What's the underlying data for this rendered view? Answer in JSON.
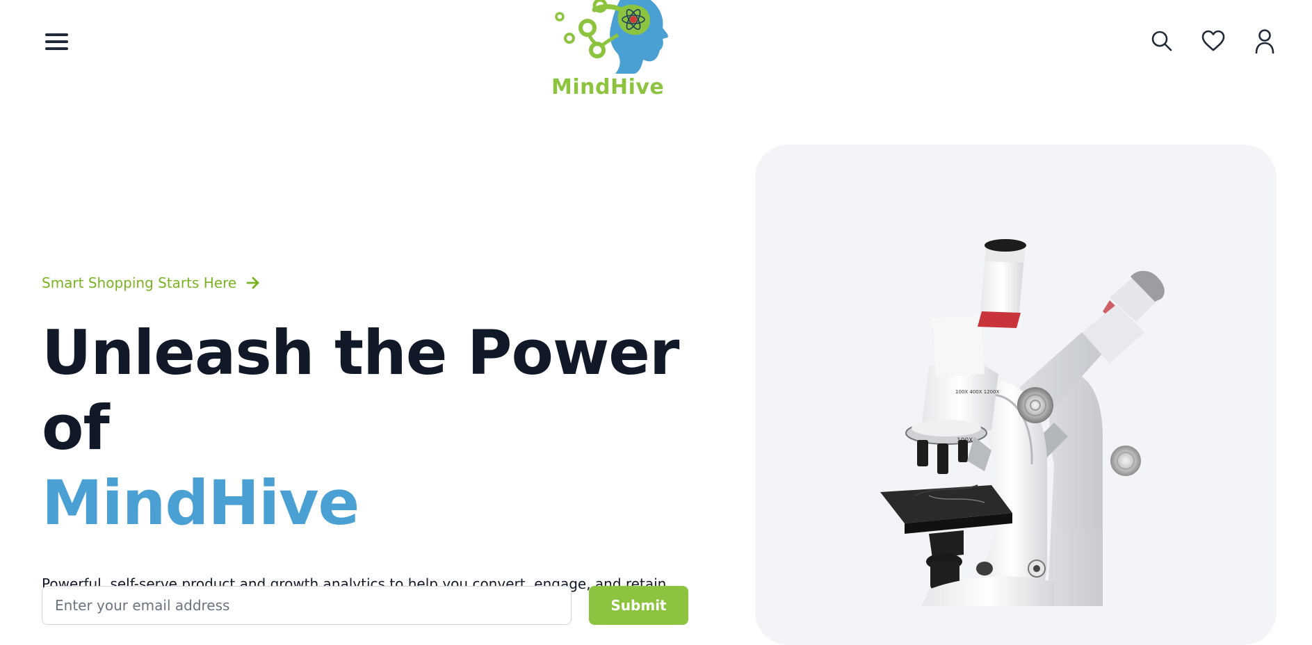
{
  "brand": {
    "name": "MindHive",
    "logo_color": "#8cc43f",
    "accent_color": "#4aa0d3"
  },
  "header": {
    "icons": [
      "menu-icon",
      "search-icon",
      "heart-icon",
      "user-icon"
    ]
  },
  "hero": {
    "eyebrow": "Smart Shopping Starts Here",
    "eyebrow_icon": "arrow-right-icon",
    "headline_line1": "Unleash the Power of",
    "headline_line2": "MindHive",
    "subtitle": "Powerful, self-serve product and growth analytics to help you convert, engage, and retain more.",
    "image": "microscope-image"
  },
  "signup": {
    "placeholder": "Enter your email address",
    "button_label": "Submit"
  },
  "colors": {
    "text": "#111827",
    "eyebrow": "#7ab321",
    "button_bg": "#8cc43f",
    "card_bg": "#f3f4f7"
  }
}
